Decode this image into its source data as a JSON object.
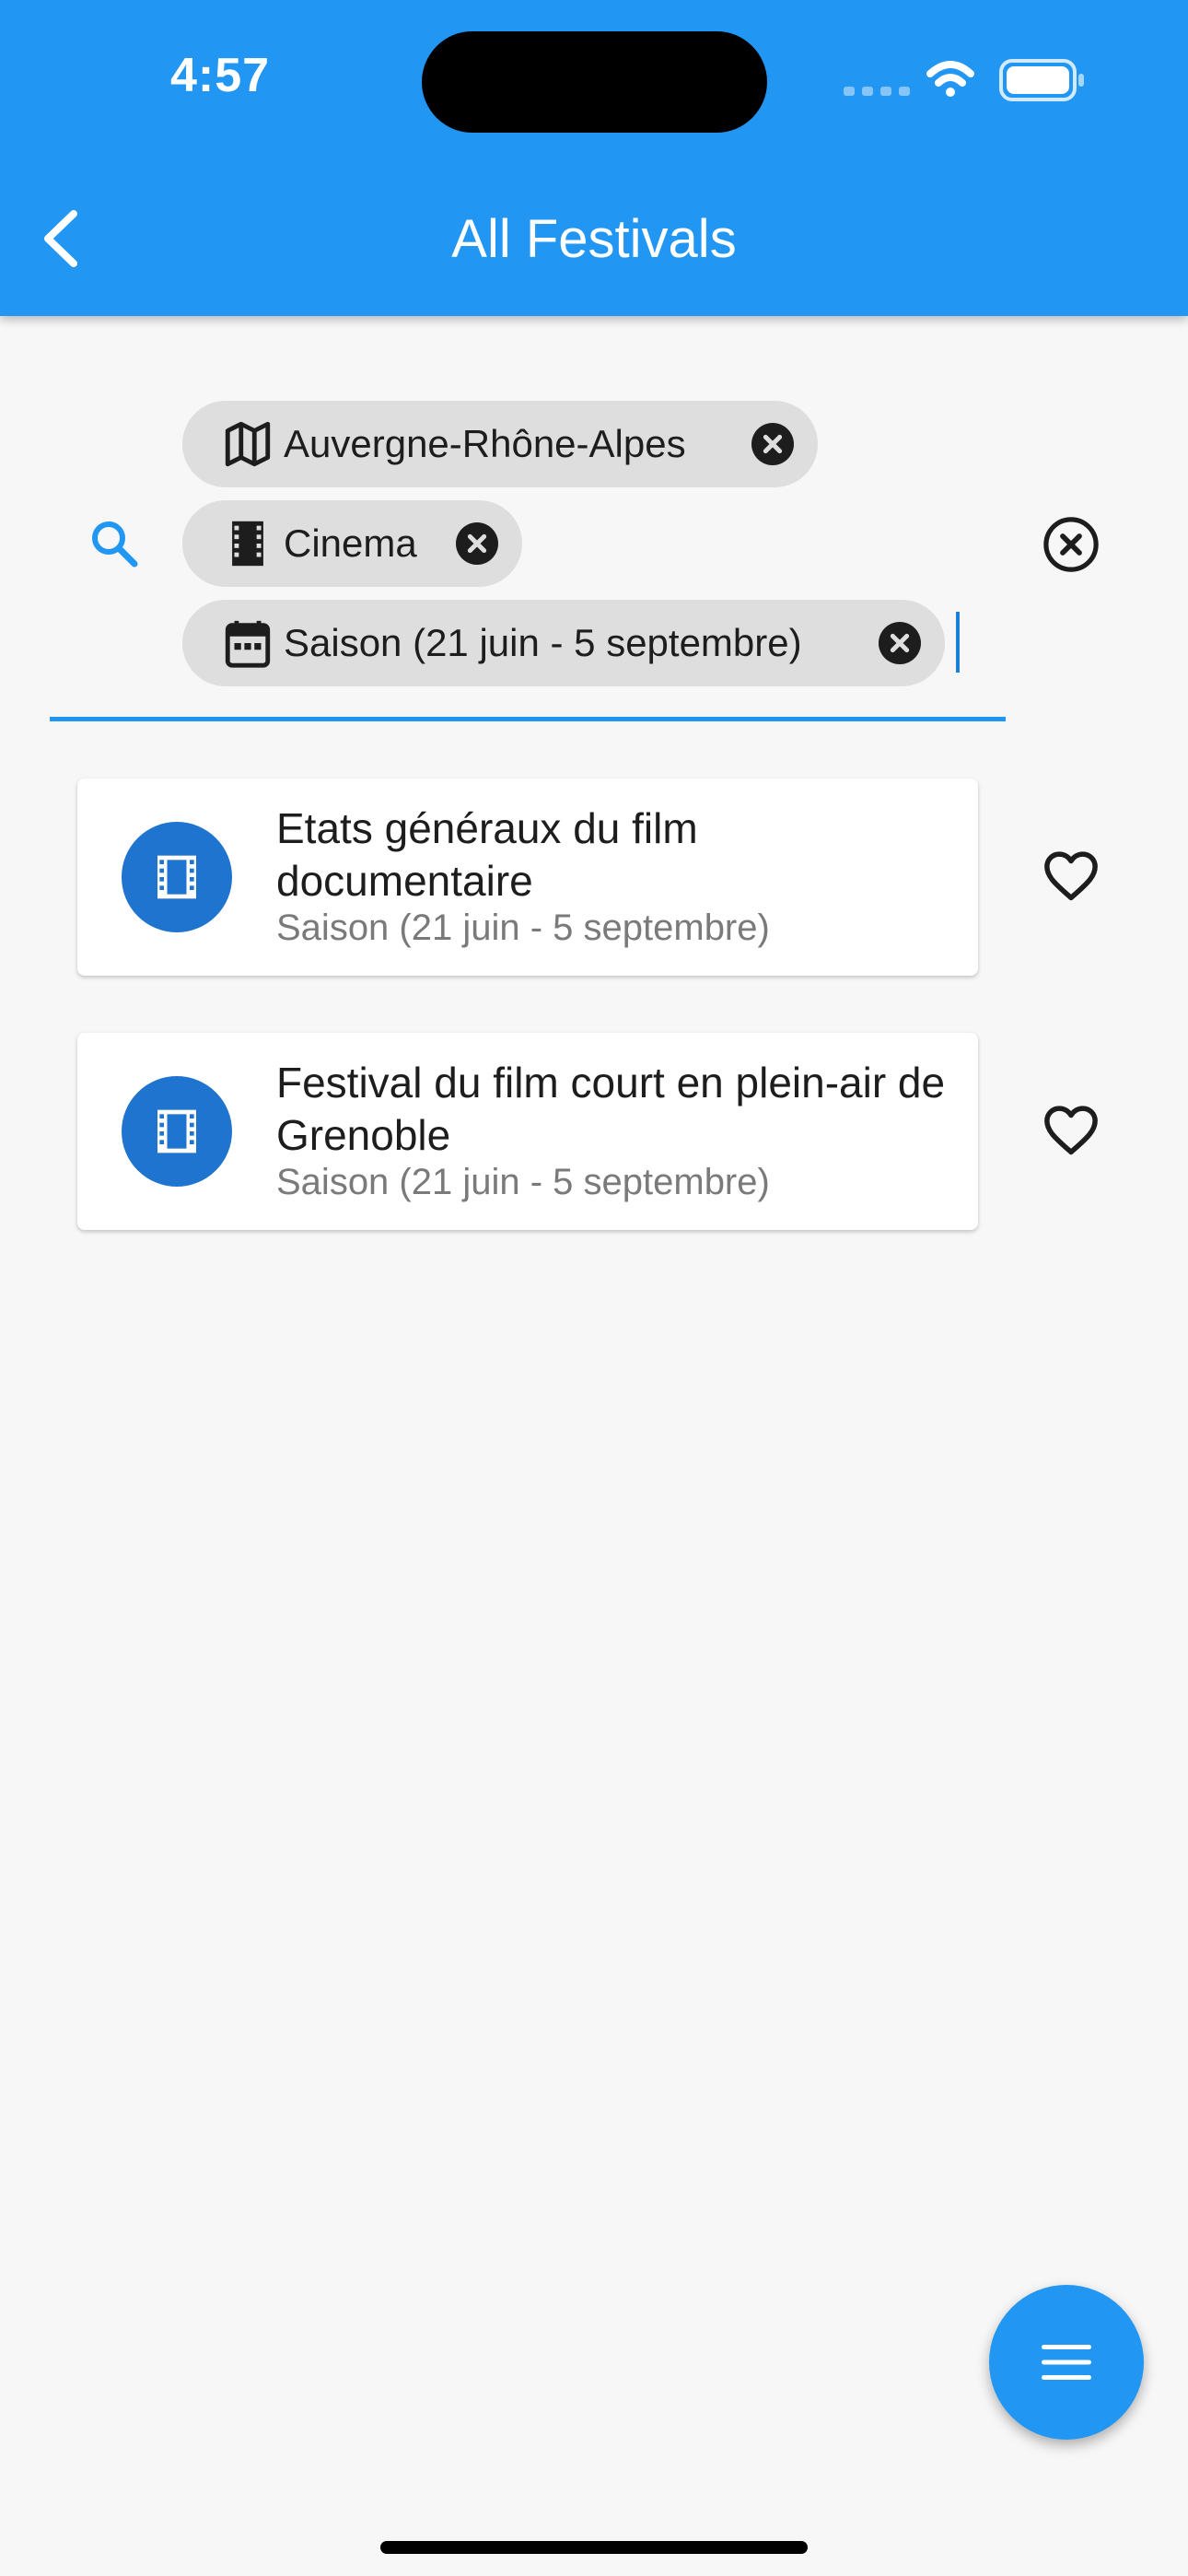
{
  "status_bar": {
    "time": "4:57"
  },
  "app_bar": {
    "title": "All Festivals"
  },
  "search": {
    "chips": [
      {
        "label": "Auvergne-Rhône-Alpes",
        "icon": "map-icon"
      },
      {
        "label": "Cinema",
        "icon": "film-icon"
      },
      {
        "label": "Saison (21 juin - 5 septembre)",
        "icon": "calendar-icon"
      }
    ]
  },
  "festivals": [
    {
      "title": "Etats généraux du film documentaire",
      "subtitle": "Saison (21 juin - 5 septembre)",
      "icon": "movie-icon"
    },
    {
      "title": "Festival du film court en plein-air de Grenoble",
      "subtitle": "Saison (21 juin - 5 septembre)",
      "icon": "movie-icon"
    }
  ],
  "colors": {
    "primary": "#2196f3",
    "avatar": "#1f74d0",
    "chip": "#dedede",
    "background": "#f7f7f7"
  },
  "fab": {
    "icon": "menu-icon"
  }
}
